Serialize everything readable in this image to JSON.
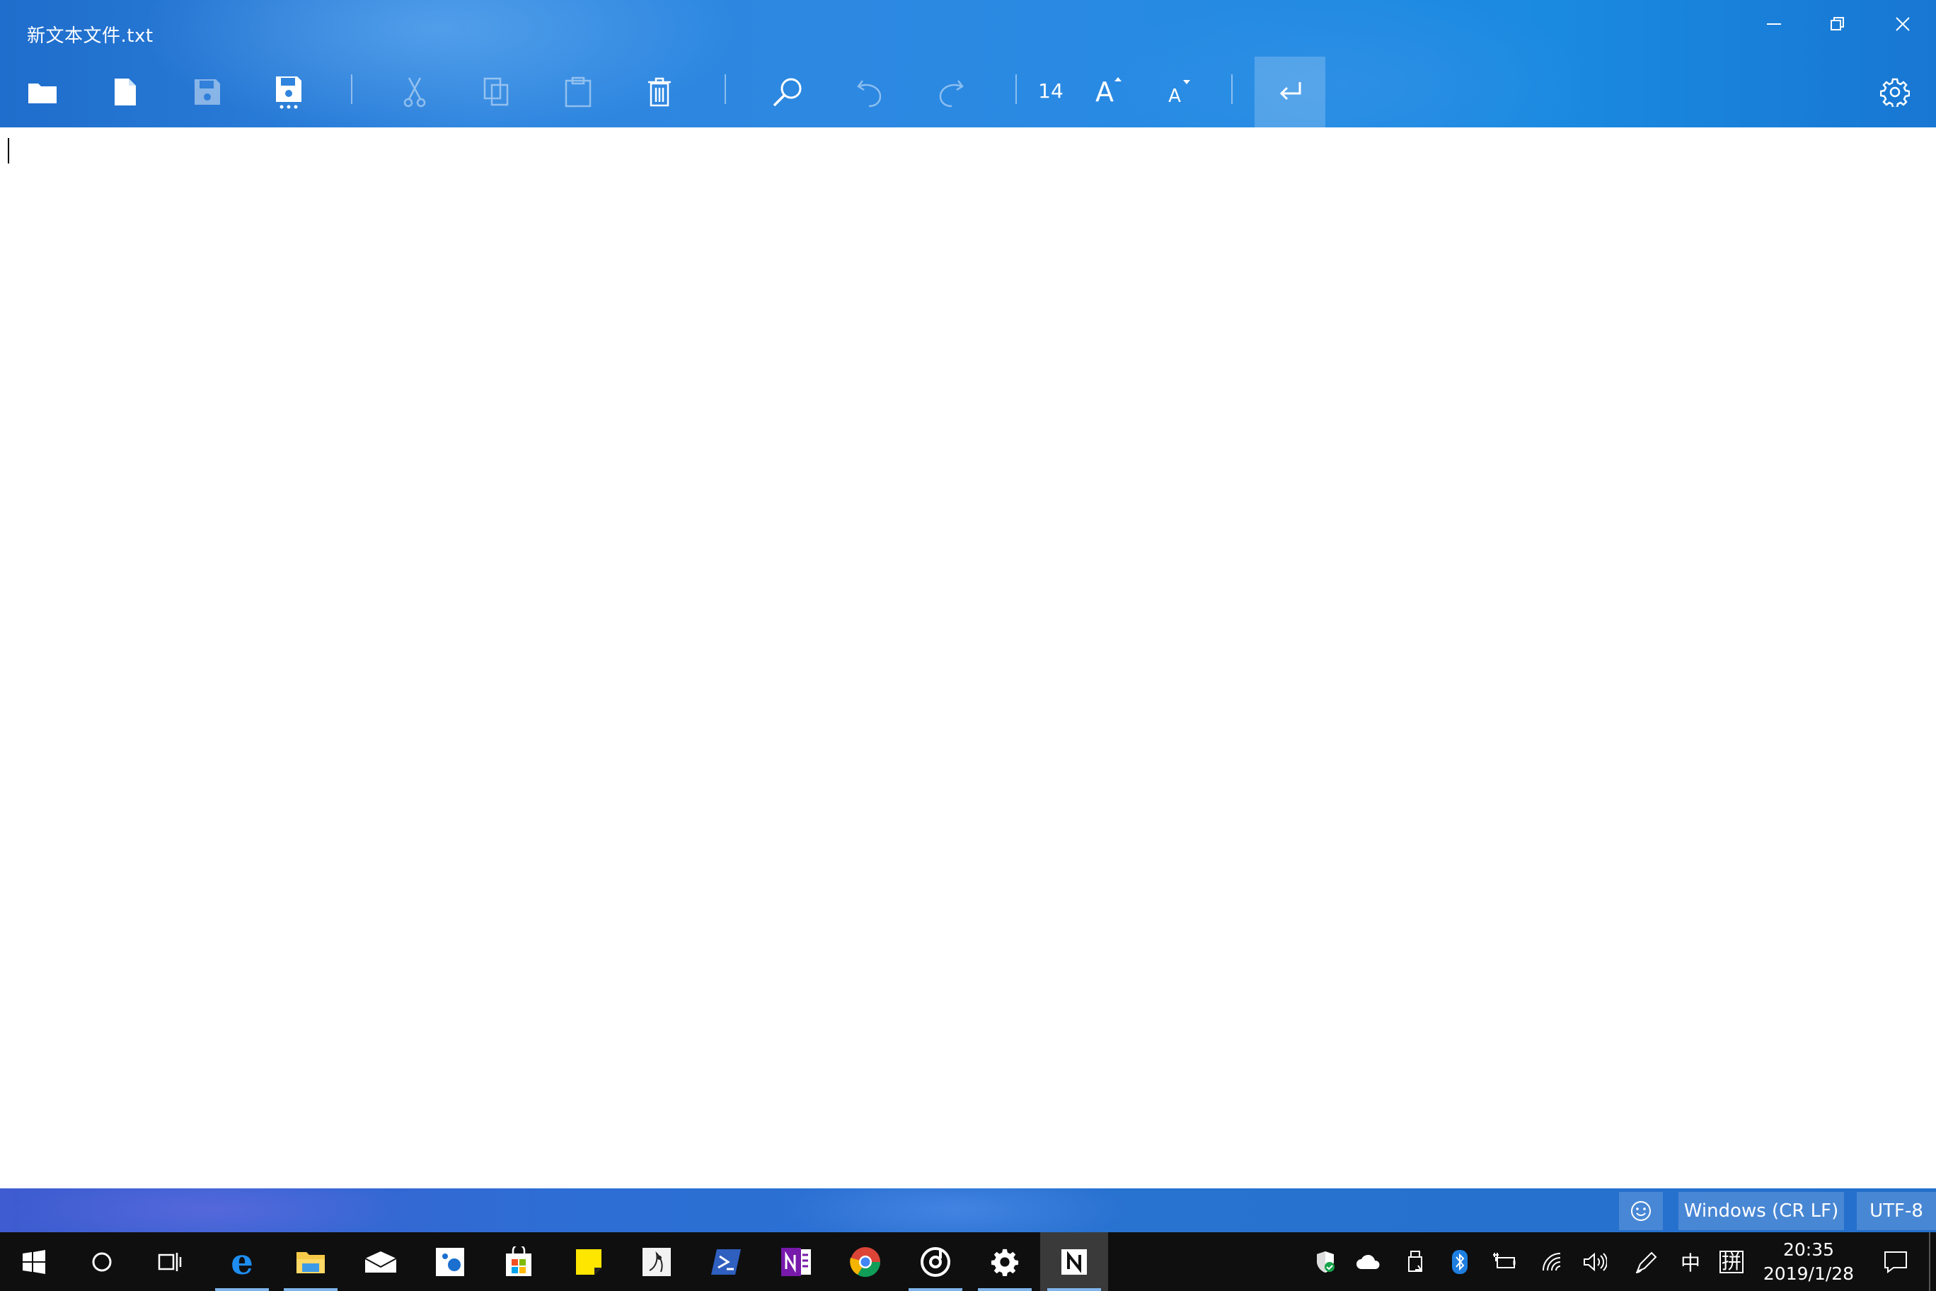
{
  "window": {
    "title": "新文本文件.txt"
  },
  "window_controls": [
    {
      "name": "minimize-button",
      "icon": "minimize-icon"
    },
    {
      "name": "restore-button",
      "icon": "restore-icon"
    },
    {
      "name": "close-button",
      "icon": "close-icon"
    }
  ],
  "toolbar": {
    "buttons": [
      {
        "name": "open-file-button",
        "icon": "folder-icon",
        "enabled": true
      },
      {
        "name": "new-file-button",
        "icon": "new-document-icon",
        "enabled": true
      },
      {
        "name": "save-button",
        "icon": "save-icon",
        "enabled": false
      },
      {
        "name": "save-as-button",
        "icon": "save-as-icon",
        "enabled": true
      },
      {
        "name": "cut-button",
        "icon": "scissors-icon",
        "enabled": false
      },
      {
        "name": "copy-button",
        "icon": "copy-icon",
        "enabled": false
      },
      {
        "name": "paste-button",
        "icon": "clipboard-icon",
        "enabled": false
      },
      {
        "name": "delete-button",
        "icon": "trash-icon",
        "enabled": true
      },
      {
        "name": "find-button",
        "icon": "search-icon",
        "enabled": true
      },
      {
        "name": "undo-button",
        "icon": "undo-icon",
        "enabled": false
      },
      {
        "name": "redo-button",
        "icon": "redo-icon",
        "enabled": false
      },
      {
        "name": "increase-font-button",
        "icon": "font-increase-icon",
        "enabled": true
      },
      {
        "name": "decrease-font-button",
        "icon": "font-decrease-icon",
        "enabled": true
      },
      {
        "name": "word-wrap-button",
        "icon": "word-wrap-icon",
        "enabled": true,
        "active": true
      },
      {
        "name": "settings-button",
        "icon": "gear-icon",
        "enabled": true
      }
    ],
    "font_size": "14",
    "font_increase_glyph": "A",
    "font_decrease_glyph": "A"
  },
  "editor": {
    "content": ""
  },
  "status_bar": {
    "feedback_icon": "smiley-icon",
    "line_ending": "Windows (CR LF)",
    "encoding": "UTF-8"
  },
  "taskbar": {
    "apps": [
      {
        "name": "start-button",
        "icon": "windows-logo-icon"
      },
      {
        "name": "cortana-button",
        "icon": "cortana-circle-icon"
      },
      {
        "name": "task-view-button",
        "icon": "task-view-icon"
      },
      {
        "name": "taskbar-edge",
        "icon": "edge-icon",
        "running": true
      },
      {
        "name": "taskbar-file-explorer",
        "icon": "folder-icon",
        "running": true
      },
      {
        "name": "taskbar-mail",
        "icon": "mail-icon"
      },
      {
        "name": "taskbar-photos",
        "icon": "photos-icon"
      },
      {
        "name": "taskbar-store",
        "icon": "store-icon"
      },
      {
        "name": "taskbar-sticky-notes",
        "icon": "sticky-notes-icon"
      },
      {
        "name": "taskbar-paint",
        "icon": "paint-icon"
      },
      {
        "name": "taskbar-powershell",
        "icon": "powershell-icon"
      },
      {
        "name": "taskbar-onenote",
        "icon": "onenote-icon"
      },
      {
        "name": "taskbar-chrome",
        "icon": "chrome-icon"
      },
      {
        "name": "taskbar-groove",
        "icon": "groove-music-icon",
        "running": true
      },
      {
        "name": "taskbar-settings",
        "icon": "gear-icon",
        "running": true
      },
      {
        "name": "taskbar-notepads",
        "icon": "notepads-icon",
        "running": true,
        "current": true
      }
    ],
    "tray": [
      {
        "name": "tray-defender",
        "icon": "shield-icon"
      },
      {
        "name": "tray-onedrive",
        "icon": "cloud-icon"
      },
      {
        "name": "tray-usb",
        "icon": "usb-icon"
      },
      {
        "name": "tray-bluetooth",
        "icon": "bluetooth-icon"
      },
      {
        "name": "tray-power",
        "icon": "battery-plug-icon"
      },
      {
        "name": "tray-wifi",
        "icon": "wifi-icon"
      },
      {
        "name": "tray-volume",
        "icon": "volume-icon"
      },
      {
        "name": "tray-pen",
        "icon": "pen-icon"
      }
    ],
    "ime_mode": "中",
    "ime_input": "拼",
    "time": "20:35",
    "date": "2019/1/28",
    "notification_icon": "notification-icon"
  }
}
